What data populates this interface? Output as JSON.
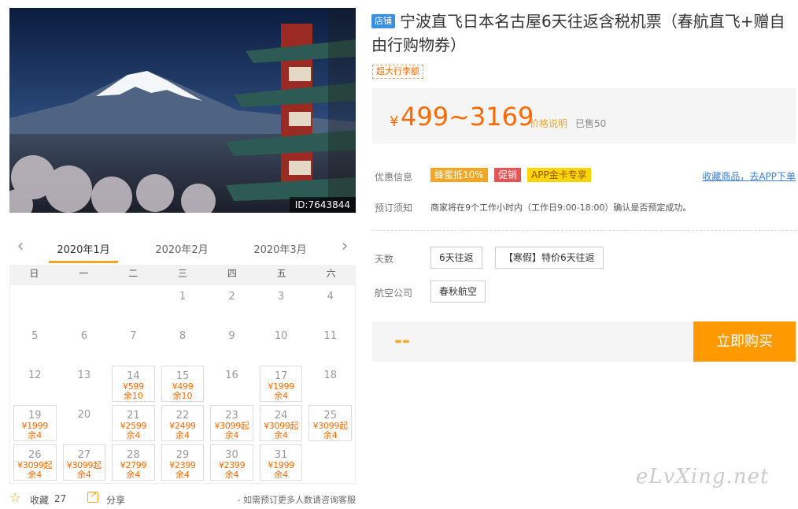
{
  "hero": {
    "id_badge": "ID:7643844"
  },
  "calendar": {
    "months": [
      "2020年1月",
      "2020年2月",
      "2020年3月"
    ],
    "weekdays": [
      "日",
      "一",
      "二",
      "三",
      "四",
      "五",
      "六"
    ],
    "weeks": [
      [
        null,
        null,
        null,
        {
          "day": "1"
        },
        {
          "day": "2"
        },
        {
          "day": "3"
        },
        {
          "day": "4"
        }
      ],
      [
        {
          "day": "5"
        },
        {
          "day": "6"
        },
        {
          "day": "7"
        },
        {
          "day": "8"
        },
        {
          "day": "9"
        },
        {
          "day": "10"
        },
        {
          "day": "11"
        }
      ],
      [
        {
          "day": "12"
        },
        {
          "day": "13"
        },
        {
          "day": "14",
          "price": "¥599",
          "stock": "余10"
        },
        {
          "day": "15",
          "price": "¥499",
          "stock": "余10"
        },
        {
          "day": "16"
        },
        {
          "day": "17",
          "price": "¥1999",
          "stock": "余4"
        },
        {
          "day": "18"
        }
      ],
      [
        {
          "day": "19",
          "price": "¥1999",
          "stock": "余4"
        },
        {
          "day": "20"
        },
        {
          "day": "21",
          "price": "¥2599",
          "stock": "余4"
        },
        {
          "day": "22",
          "price": "¥2499",
          "stock": "余4"
        },
        {
          "day": "23",
          "price": "¥3099起",
          "stock": "余4"
        },
        {
          "day": "24",
          "price": "¥3099起",
          "stock": "余4"
        },
        {
          "day": "25",
          "price": "¥3099起",
          "stock": "余4"
        }
      ],
      [
        {
          "day": "26",
          "price": "¥3099起",
          "stock": "余4"
        },
        {
          "day": "27",
          "price": "¥3099起",
          "stock": "余4"
        },
        {
          "day": "28",
          "price": "¥2799",
          "stock": "余4"
        },
        {
          "day": "29",
          "price": "¥2399",
          "stock": "余4"
        },
        {
          "day": "30",
          "price": "¥2399",
          "stock": "余4"
        },
        {
          "day": "31",
          "price": "¥1999",
          "stock": "余4"
        },
        null
      ]
    ]
  },
  "actions": {
    "favorite_label": "收藏",
    "favorite_count": "27",
    "share_label": "分享",
    "consult_note": "- 如需预订更多人数请咨询客服"
  },
  "product": {
    "shop_tag": "店铺",
    "title": "宁波直飞日本名古屋6天往返含税机票（春航直飞+赠自由行购物券）",
    "luggage_tag": "超大行李额",
    "currency": "¥",
    "price_range": "499~3169",
    "price_note": "价格说明",
    "sold": "已售50"
  },
  "offers": {
    "label": "优惠信息",
    "tags": [
      "蜂蜜抵10%",
      "促销",
      "APP金卡专享"
    ],
    "app_link": "收藏商品，去APP下单"
  },
  "booking": {
    "label": "预订须知",
    "text": "商家将在9个工作小时内（工作日9:00-18:00）确认是否预定成功。"
  },
  "options": {
    "days_label": "天数",
    "days": [
      "6天往返",
      "【寒假】特价6天往返"
    ],
    "airline_label": "航空公司",
    "airlines": [
      "春秋航空"
    ]
  },
  "purchase": {
    "price_placeholder": "--",
    "buy_label": "立即购买"
  },
  "watermark": "eLvXing.net",
  "colors": {
    "accent": "#ff6a00",
    "buy": "#ff9900",
    "tab_underline": "#f5a623",
    "link": "#3b7dd8"
  }
}
